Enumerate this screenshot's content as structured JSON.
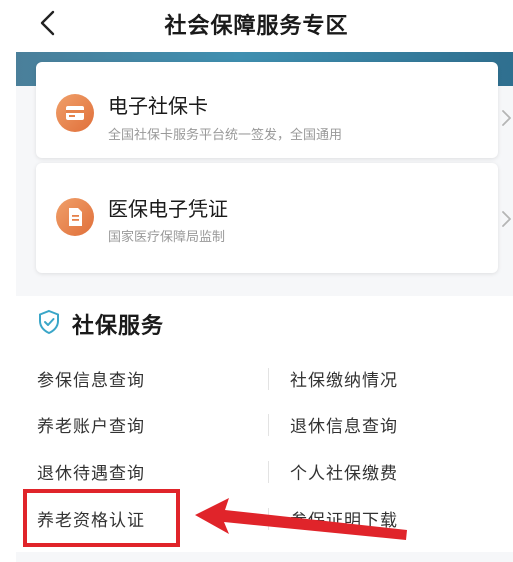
{
  "nav": {
    "title": "社会保障服务专区",
    "back_icon": "chevron-left-icon"
  },
  "cards": [
    {
      "icon": "card-icon",
      "title": "电子社保卡",
      "subtitle": "全国社保卡服务平台统一签发，全国通用",
      "chevron": "chevron-right-icon"
    },
    {
      "icon": "document-icon",
      "title": "医保电子凭证",
      "subtitle": "国家医疗保障局监制",
      "chevron": "chevron-right-icon"
    }
  ],
  "section": {
    "icon": "shield-check-icon",
    "title": "社保服务"
  },
  "services": {
    "left": [
      "参保信息查询",
      "养老账户查询",
      "退休待遇查询",
      "养老资格认证"
    ],
    "right": [
      "社保缴纳情况",
      "退休信息查询",
      "个人社保缴费",
      "参保证明下载"
    ]
  },
  "annotation": {
    "highlight_color": "#e0242a",
    "highlighted_item": "养老资格认证"
  },
  "colors": {
    "banner": "#3f8fb0",
    "icon_orange": "#e06f3a"
  }
}
